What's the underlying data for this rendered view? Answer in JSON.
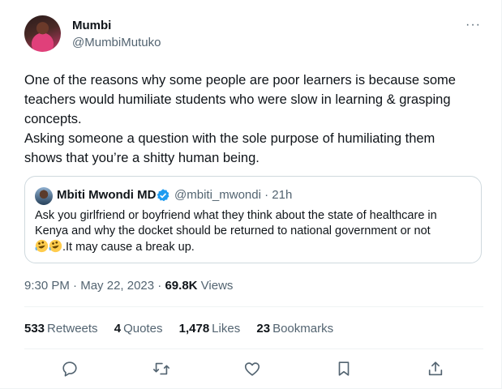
{
  "tweet": {
    "author_name": "Mumbi",
    "author_handle": "@MumbiMutuko",
    "more_label": "···",
    "text": "One of the reasons why some people are poor learners is because some\nteachers would humiliate students who were slow in learning & grasping\nconcepts.\nAsking someone a question with the sole purpose of humiliating them\nshows that you’re a shitty human being.",
    "time": "9:30 PM",
    "date": "May 22, 2023",
    "views_count": "69.8K",
    "views_label": "Views"
  },
  "quote": {
    "author_name": "Mbiti Mwondi MD",
    "author_handle": "@mbiti_mwondi",
    "age": "21h",
    "text": "Ask you girlfriend or boyfriend what they think about the state of healthcare in\nKenya and why the docket should be returned to national government or not\n",
    "text_tail": ".It may cause a break up.",
    "emoji": "rolling-on-floor-laughing-emoji"
  },
  "stats": {
    "retweets_count": "533",
    "retweets_label": "Retweets",
    "quotes_count": "4",
    "quotes_label": "Quotes",
    "likes_count": "1,478",
    "likes_label": "Likes",
    "bookmarks_count": "23",
    "bookmarks_label": "Bookmarks"
  },
  "icons": [
    "reply-icon",
    "retweet-icon",
    "like-icon",
    "bookmark-icon",
    "share-icon",
    "verified-badge-icon"
  ],
  "colors": {
    "text": "#0f1419",
    "secondary": "#536471",
    "verified": "#1d9bf0",
    "border": "#cfd9de",
    "divider": "#eff3f4"
  }
}
